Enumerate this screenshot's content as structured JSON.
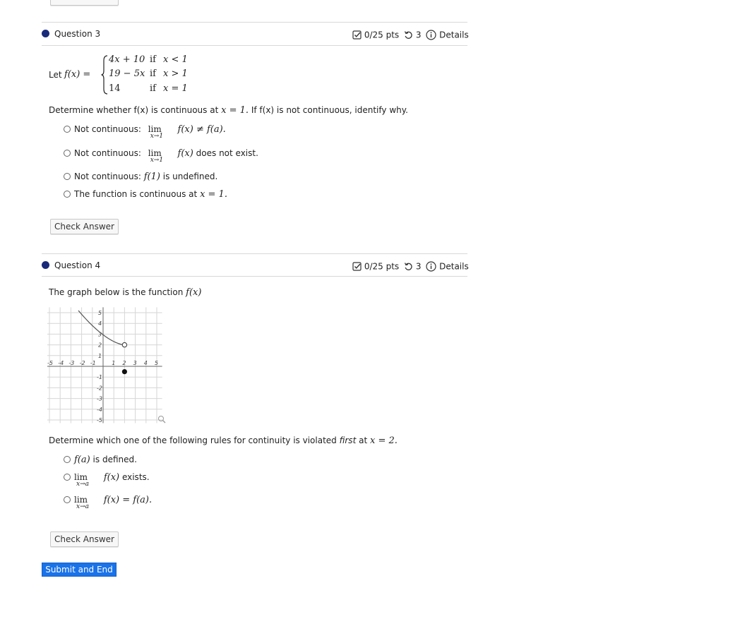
{
  "questions": [
    {
      "title": "Question 3",
      "score": "0/25 pts",
      "attempts": "3",
      "details": "Details",
      "let_text": "Let",
      "f_def": "f(x) =",
      "cases": [
        {
          "expr": "4x + 10",
          "cond_word": "if",
          "cond": "x < 1"
        },
        {
          "expr": "19 − 5x",
          "cond_word": "if",
          "cond": "x > 1"
        },
        {
          "expr": "14",
          "cond_word": "if",
          "cond": "x = 1"
        }
      ],
      "prompt_prefix": "Determine whether f(x) is continuous at",
      "prompt_math": "x = 1.",
      "prompt_suffix": "If f(x) is not continuous, identify why.",
      "options": [
        {
          "label": "Not continuous:",
          "lim": "lim",
          "lim_sub": "x→1",
          "tail": "f(x) ≠ f(a)."
        },
        {
          "label": "Not continuous:",
          "lim": "lim",
          "lim_sub": "x→1",
          "tail_math": "f(x)",
          "tail_text": "does not exist."
        },
        {
          "label": "Not continuous:",
          "tail_math": "f(1)",
          "tail_text": "is undefined."
        },
        {
          "label": "The function is continuous at",
          "tail_math": "x = 1."
        }
      ],
      "check_label": "Check Answer"
    },
    {
      "title": "Question 4",
      "score": "0/25 pts",
      "attempts": "3",
      "details": "Details",
      "intro_text": "The graph below is the function",
      "intro_math": "f(x)",
      "prompt_prefix": "Determine which one of the following rules for continuity is violated",
      "prompt_em": "first",
      "prompt_mid": "at",
      "prompt_math": "x = 2.",
      "options": [
        {
          "tail_math": "f(a)",
          "tail_text": "is defined."
        },
        {
          "lim": "lim",
          "lim_sub": "x→a",
          "tail_math": "f(x)",
          "tail_text": "exists."
        },
        {
          "lim": "lim",
          "lim_sub": "x→a",
          "tail_math": "f(x) = f(a)."
        }
      ],
      "check_label": "Check Answer"
    }
  ],
  "graph": {
    "x_ticks": [
      "-5",
      "-4",
      "-3",
      "-2",
      "-1",
      "1",
      "2",
      "3",
      "4",
      "5"
    ],
    "y_ticks_pos": [
      "5",
      "4",
      "3",
      "2",
      "1"
    ],
    "y_ticks_neg": [
      "-1",
      "-2",
      "-3",
      "-4",
      "-5"
    ],
    "curve_color": "#555555",
    "open_point": {
      "x": 2,
      "y": 2
    },
    "closed_point": {
      "x": 2,
      "y": -0.5
    }
  },
  "submit_label": "Submit and End",
  "colors": {
    "accent": "#1a73e8",
    "bullet": "#1a2a7a"
  }
}
